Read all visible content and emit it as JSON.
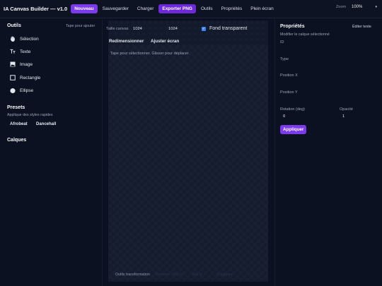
{
  "topbar": {
    "title": "IA Canvas Builder — v1.0",
    "buttons": {
      "new": "Nouveau",
      "save": "Sauvegarder",
      "load": "Charger",
      "export": "Exporter PNG",
      "tools": "Outils",
      "properties": "Propriétés",
      "fullscreen": "Plein écran"
    },
    "zoom_label": "Zoom",
    "zoom_value": "100%"
  },
  "left": {
    "tools_title": "Outils",
    "tools_hint": "Tape pour ajouter",
    "tools": [
      {
        "label": "Sélection",
        "icon": "hand-icon"
      },
      {
        "label": "Texte",
        "icon": "text-icon"
      },
      {
        "label": "Image",
        "icon": "image-icon"
      },
      {
        "label": "Rectangle",
        "icon": "rectangle-icon"
      },
      {
        "label": "Ellipse",
        "icon": "ellipse-icon"
      }
    ],
    "presets_title": "Presets",
    "presets_hint": "Applique des styles rapides",
    "presets": [
      "Afrobeat",
      "Dancehall"
    ],
    "layers_title": "Calques"
  },
  "center": {
    "size_label": "Taille canvas",
    "width": "1024",
    "height": "1024",
    "transparent_label": "Fond transparent",
    "transparent_checked": true,
    "resize_button": "Redimensionner",
    "fit_button": "Ajuster écran",
    "canvas_hint": "Tape pour sélectionner. Glisser pour déplacer.",
    "transform_label": "Outils transformation",
    "transform_buttons": [
      "Rotation",
      "Flip H",
      "Flip V",
      "Dupliquer"
    ]
  },
  "right": {
    "title": "Propriétés",
    "edit_text_button": "Éditer texte",
    "subtitle": "Modifier le calque sélectionné",
    "fields": {
      "id_label": "ID",
      "type_label": "Type",
      "posx_label": "Position X",
      "posy_label": "Position Y",
      "rotation_label": "Rotation (deg)",
      "rotation_value": "0",
      "opacity_label": "Opacité",
      "opacity_value": "1"
    },
    "apply_button": "Appliquer"
  },
  "colors": {
    "accent": "#7c3aed",
    "background": "#0b1120",
    "canvas": "#141c2e",
    "checkbox": "#3b82f6"
  }
}
